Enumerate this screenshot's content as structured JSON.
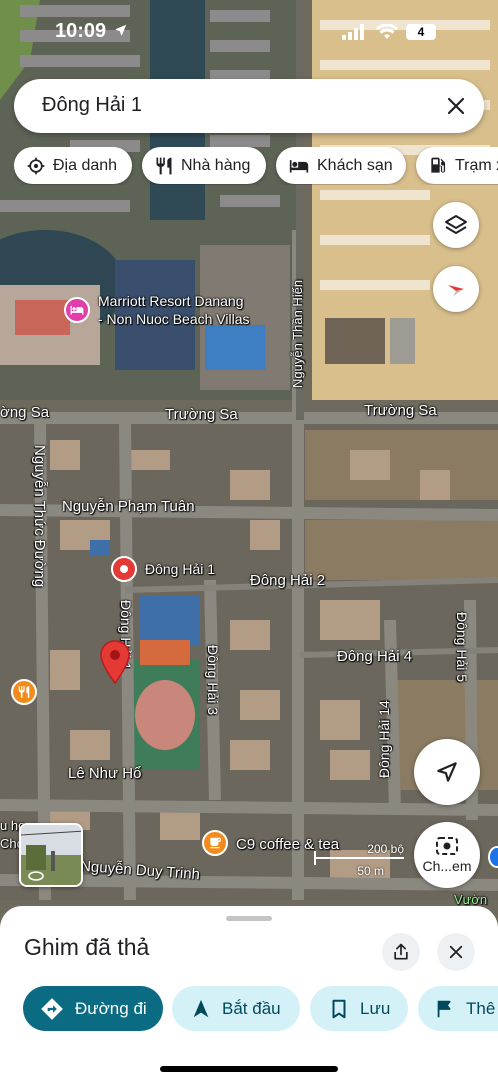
{
  "status_bar": {
    "time": "10:09",
    "battery": "4"
  },
  "search": {
    "query": "Đông Hải 1"
  },
  "chips": [
    {
      "label": "Địa danh",
      "icon": "landmark-icon"
    },
    {
      "label": "Nhà hàng",
      "icon": "restaurant-icon"
    },
    {
      "label": "Khách sạn",
      "icon": "hotel-icon"
    },
    {
      "label": "Trạm x",
      "icon": "gas-station-icon"
    }
  ],
  "map": {
    "roads": {
      "truong_sa_left": "ờng Sa",
      "truong_sa_mid": "Trường Sa",
      "truong_sa_right": "Trường Sa",
      "nguyen_thai_hien": "Nguyễn Thần Hiến",
      "nguyen_thuc_duong": "Nguyễn Thức Đường",
      "nguyen_pham_tuan": "Nguyễn Phạm Tuân",
      "dong_hai_1": "Đông Hải 1",
      "dong_hai_2": "Đông Hải 2",
      "dong_hai_3": "Đông Hải 3",
      "dong_hai_4": "Đông Hải 4",
      "dong_hai_5": "Đông Hải 5",
      "dong_hai_14": "Đông Hải 14",
      "le_nhu_ho": "Lê Như Hổ",
      "nguyen_duy_trinh": "Nguyễn Duy Trinh",
      "vuon": "Vườn",
      "edge_u": "u họ",
      "edge_chc": "Chc"
    },
    "pois": {
      "marriott_line1": "Marriott Resort Danang",
      "marriott_line2": "- Non Nuoc Beach Villas",
      "pin_label": "Đông Hải 1",
      "coffee": "C9 coffee & tea"
    },
    "scale": {
      "top": "200 bộ",
      "bottom": "50 m"
    },
    "street_view_label": "Ch...em"
  },
  "sheet": {
    "title": "Ghim đã thả",
    "actions": [
      {
        "label": "Đường đi",
        "icon": "directions-icon"
      },
      {
        "label": "Bắt đầu",
        "icon": "navigation-arrow-icon"
      },
      {
        "label": "Lưu",
        "icon": "bookmark-icon"
      },
      {
        "label": "Thê",
        "icon": "flag-icon"
      }
    ]
  },
  "colors": {
    "accent": "#0b6b82",
    "accent_light": "#d5f1f8",
    "pin_red": "#e53935",
    "brand_pink": "#e23da8",
    "orange_poi": "#f28b1c"
  }
}
